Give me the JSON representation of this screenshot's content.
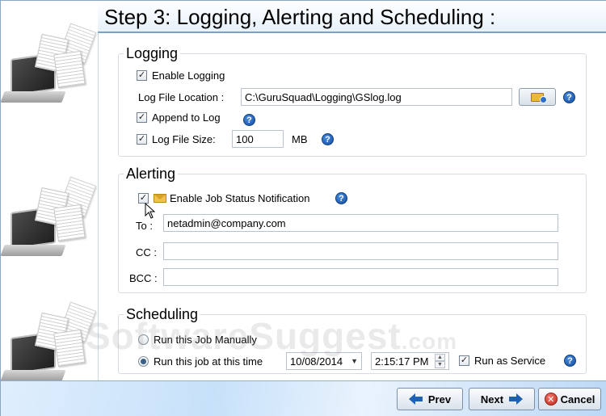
{
  "header": {
    "title": "Step 3: Logging, Alerting and Scheduling :"
  },
  "logging": {
    "legend": "Logging",
    "enable_logging": {
      "label": "Enable Logging",
      "checked": true
    },
    "location_label": "Log File Location :",
    "location_value": "C:\\GuruSquad\\Logging\\GSlog.log",
    "append": {
      "label": "Append to Log",
      "checked": true
    },
    "size": {
      "label": "Log File Size:",
      "checked": true,
      "value": "100",
      "unit": "MB"
    }
  },
  "alerting": {
    "legend": "Alerting",
    "enable_notification": {
      "label": "Enable Job Status Notification",
      "checked": true
    },
    "to_label": "To :",
    "to_value": "netadmin@company.com",
    "cc_label": "CC :",
    "cc_value": "",
    "bcc_label": "BCC :",
    "bcc_value": ""
  },
  "scheduling": {
    "legend": "Scheduling",
    "manual": {
      "label": "Run this Job Manually",
      "selected": false
    },
    "timed": {
      "label": "Run this job at this time",
      "selected": true
    },
    "date": "10/08/2014",
    "time": "2:15:17 PM",
    "service": {
      "label": "Run as Service",
      "checked": true
    }
  },
  "icons": {
    "help": "?",
    "check": "✓",
    "cancel": "✕"
  },
  "watermark": {
    "main": "SoftwareSuggest",
    "suffix": ".com"
  },
  "footer": {
    "prev_label": "Prev",
    "next_label": "Next",
    "cancel_label": "Cancel"
  },
  "colors": {
    "accent": "#1e60b4",
    "header_border": "#7aa1c8"
  }
}
